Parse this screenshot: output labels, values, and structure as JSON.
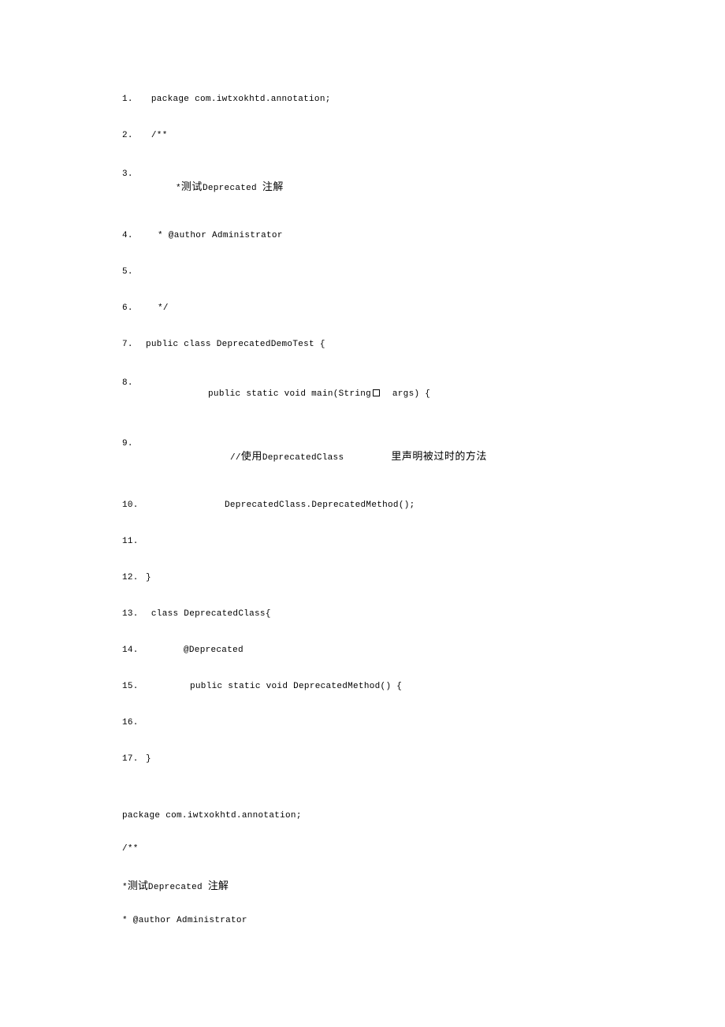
{
  "numbered": [
    {
      "num": "1.",
      "text": " package com.iwtxokhtd.annotation;",
      "indent": ""
    },
    {
      "num": "2.",
      "text": " /**",
      "indent": ""
    },
    {
      "num": "3.",
      "text": "*测试Deprecated 注解",
      "indent": "",
      "extraPad": "15",
      "cjk": true
    },
    {
      "num": "4.",
      "text": "* @author Administrator",
      "indent": "",
      "extraPad": "15"
    },
    {
      "num": "5.",
      "text": "",
      "indent": ""
    },
    {
      "num": "6.",
      "text": "*/",
      "indent": "",
      "extraPad": "15"
    },
    {
      "num": "7.",
      "text": "public class DeprecatedDemoTest {",
      "indent": ""
    },
    {
      "num": "8.",
      "text": "public static void main(String",
      "tail": "  args) {",
      "indent": "indent1",
      "box": true
    },
    {
      "num": "9.",
      "text": "//使用DeprecatedClass",
      "tail2": "里声明被过时的方法",
      "indent": "indent2",
      "cjk2": true
    },
    {
      "num": "10.",
      "text": "DeprecatedClass.DeprecatedMethod();",
      "indent": "indent3"
    },
    {
      "num": "11.",
      "text": "",
      "indent": ""
    },
    {
      "num": "12.",
      "text": "}",
      "indent": ""
    },
    {
      "num": "13.",
      "text": " class DeprecatedClass{",
      "indent": ""
    },
    {
      "num": "14.",
      "text": "@Deprecated",
      "indent": "indent-sm"
    },
    {
      "num": "15.",
      "text": "public static void DeprecatedMethod() {",
      "indent": "indent-sm2"
    },
    {
      "num": "16.",
      "text": "",
      "indent": ""
    },
    {
      "num": "17.",
      "text": "}",
      "indent": ""
    }
  ],
  "plain": [
    "package com.iwtxokhtd.annotation;",
    "/**",
    "*测试Deprecated 注解",
    "* @author Administrator"
  ]
}
